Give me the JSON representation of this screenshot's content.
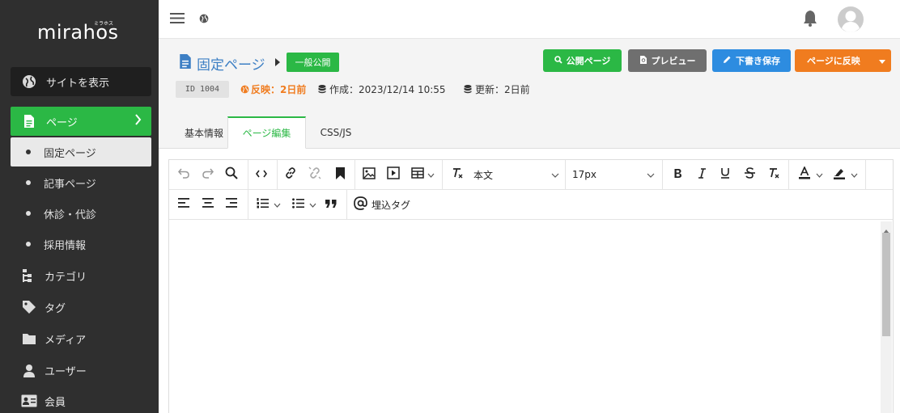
{
  "brand": {
    "logo": "mirahos",
    "logo_kana": "ミラホス"
  },
  "sidebar": {
    "site_view": "サイトを表示",
    "page": "ページ",
    "sub_items": [
      "固定ページ",
      "記事ページ",
      "休診・代診",
      "採用情報"
    ],
    "main_items": [
      "カテゴリ",
      "タグ",
      "メディア",
      "ユーザー",
      "会員"
    ]
  },
  "page": {
    "title": "固定ページ",
    "status_badge": "一般公開",
    "id_label": "ID 1004",
    "reflect": "反映：2日前",
    "created": "作成：2023/12/14 10:55",
    "updated": "更新：2日前"
  },
  "actions": {
    "public_page": "公開ページ",
    "preview": "プレビュー",
    "draft_save": "下書き保存",
    "reflect_page": "ページに反映"
  },
  "tabs": [
    "基本情報",
    "ページ編集",
    "CSS/JS"
  ],
  "toolbar": {
    "paragraph_style": "本文",
    "font_size": "17px",
    "embed_tag": "埋込タグ"
  },
  "colors": {
    "sidebar_bg": "#2f2f2f",
    "green": "#2bb845",
    "gray": "#6f6f6f",
    "blue": "#2d8ce0",
    "orange": "#f07c1f",
    "title_blue": "#3d7fc4"
  }
}
